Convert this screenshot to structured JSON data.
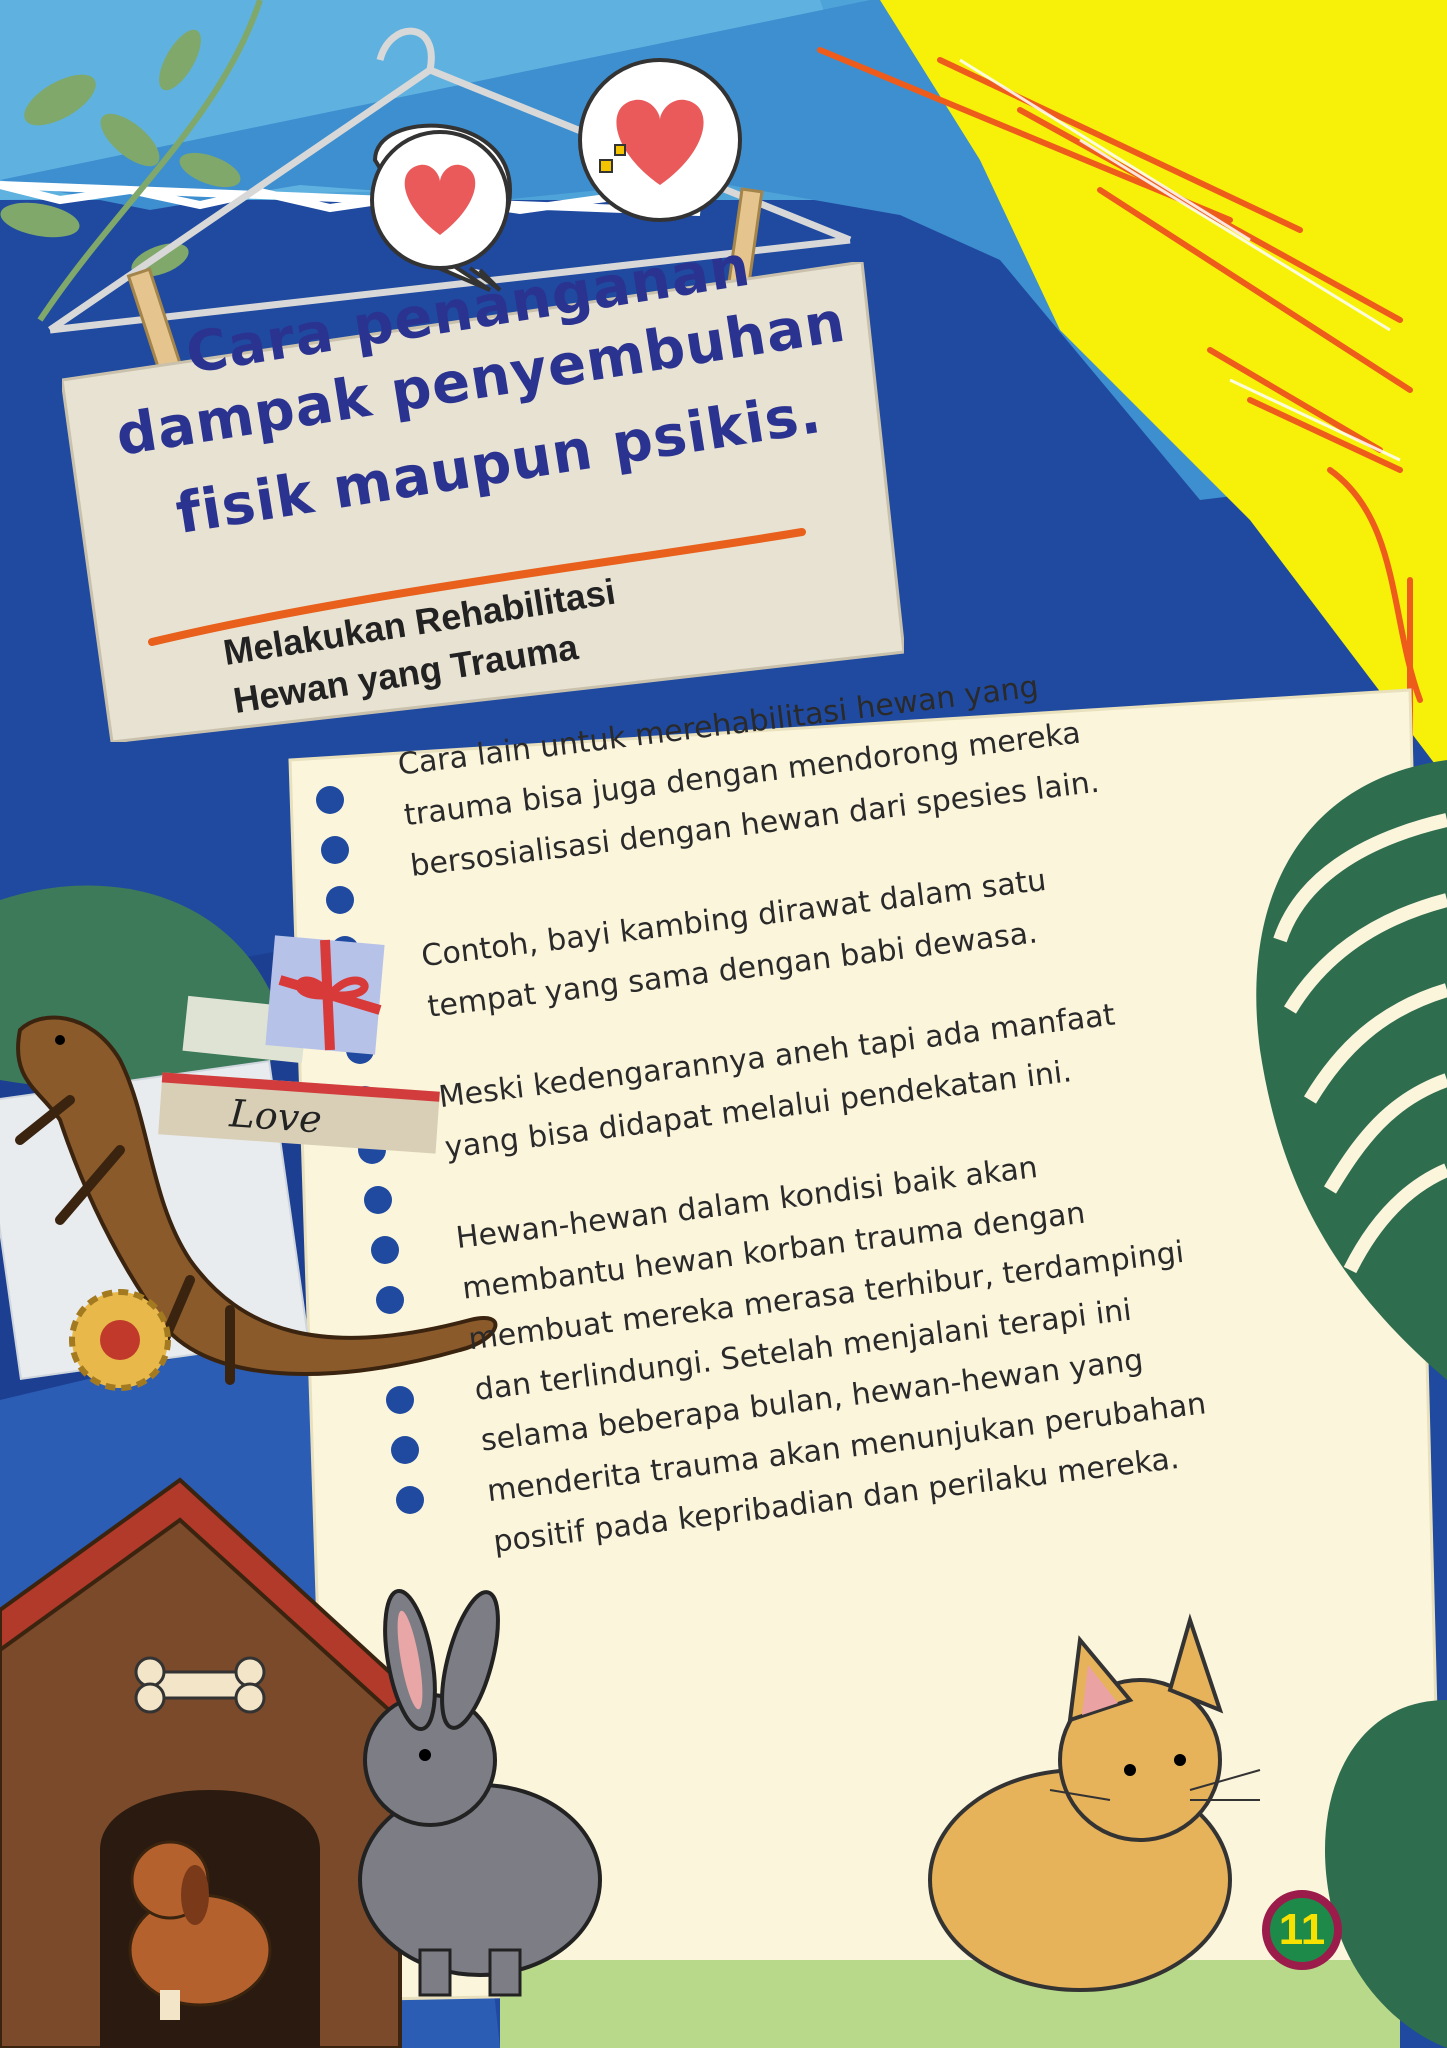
{
  "title_card": {
    "lines": [
      "Cara penanganan",
      "dampak  penyembuhan",
      "fisik maupun psikis."
    ],
    "subtitle_lines": [
      "Melakukan Rehabilitasi",
      "Hewan yang Trauma"
    ]
  },
  "body": {
    "paragraphs": [
      "Cara lain untuk merehabilitasi hewan yang\ntrauma bisa juga dengan mendorong mereka\nbersosialisasi dengan hewan dari spesies lain.",
      "Contoh, bayi kambing dirawat dalam satu\ntempat yang sama dengan babi dewasa.",
      "Meski kedengarannya aneh tapi ada manfaat\nyang bisa didapat melalui pendekatan ini.",
      "Hewan-hewan dalam kondisi baik akan\nmembantu hewan korban trauma dengan\nmembuat mereka merasa terhibur, terdampingi\ndan terlindungi. Setelah menjalani terapi ini\nselama beberapa bulan, hewan-hewan yang\nmenderita trauma akan menunjukan perubahan\npositif pada kepribadian dan perilaku mereka."
    ]
  },
  "decor": {
    "love_label": "Love",
    "page_number": "11"
  },
  "icons": [
    "heart-icon",
    "clothes-hanger-icon",
    "clothespin-icon",
    "gift-bow-icon",
    "gear-button-icon",
    "bone-icon",
    "dog-house-icon",
    "dog-icon",
    "rabbit-icon",
    "cat-icon",
    "lizard-icon",
    "leaf-icon"
  ],
  "colors": {
    "title_blue": "#2b3390",
    "accent_orange": "#e8601c",
    "yellow": "#f7f10a",
    "deep_blue": "#1f4aa0",
    "paper": "#fbf5dc",
    "badge_green": "#1d8a4a",
    "badge_ring": "#9b1b4b"
  }
}
